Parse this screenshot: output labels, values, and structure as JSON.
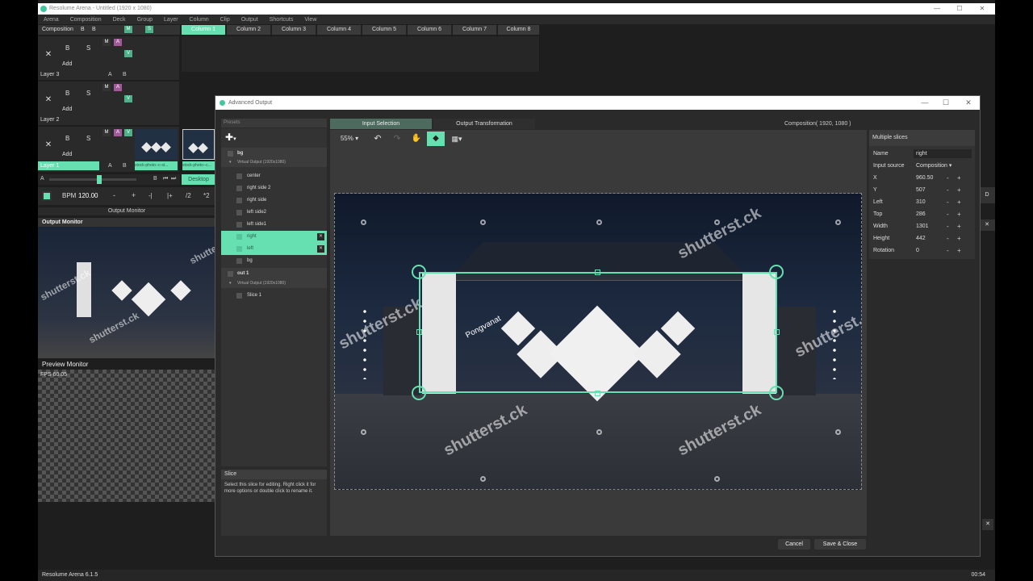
{
  "app": {
    "title": "Resolume Arena - Untitled (1920 x 1080)",
    "version": "Resolume Arena 6.1.5",
    "clock": "00:54",
    "accent": "#66e0b0"
  },
  "menu": [
    "Arena",
    "Composition",
    "Deck",
    "Group",
    "Layer",
    "Column",
    "Clip",
    "Output",
    "Shortcuts",
    "View"
  ],
  "composition": {
    "label": "Composition",
    "b": "B",
    "m": "M",
    "s": "S"
  },
  "columns": [
    "Column 1",
    "Column 2",
    "Column 3",
    "Column 4",
    "Column 5",
    "Column 6",
    "Column 7",
    "Column 8"
  ],
  "layers": [
    {
      "name": "Layer 3",
      "add": "Add"
    },
    {
      "name": "Layer 2",
      "add": "Add"
    },
    {
      "name": "Layer 1",
      "add": "Add"
    }
  ],
  "layer_buttons": {
    "b": "B",
    "s": "S",
    "m": "M",
    "a": "A",
    "v": "V",
    "close": "✕"
  },
  "clips": [
    "stock-photo--c-st...",
    "stock-photo--c..."
  ],
  "crossfader": {
    "a": "A",
    "b": "B",
    "deck": "Desktop"
  },
  "bpm": {
    "label": "BPM",
    "value": "120.00",
    "minus": "-",
    "plus": "+",
    "half": "/2",
    "double": "*2",
    "prev": "-|",
    "next": "|+"
  },
  "output_monitor": {
    "header": "Output Monitor",
    "label": "Output Monitor"
  },
  "preview_monitor": {
    "label": "Preview Monitor",
    "fps": "FPS 60.05"
  },
  "advanced": {
    "title": "Advanced Output",
    "presets": "Presets",
    "tabs": [
      "Input Selection",
      "Output Transformation"
    ],
    "composition_info": "Composition( 1920, 1080 )",
    "zoom": "55%",
    "tree": [
      {
        "label": "bg",
        "type": "group"
      },
      {
        "label": "Virtual Output (1920x1080)",
        "type": "sub"
      },
      {
        "label": "center",
        "type": "item"
      },
      {
        "label": "right side 2",
        "type": "item"
      },
      {
        "label": "right side",
        "type": "item"
      },
      {
        "label": "left side2",
        "type": "item"
      },
      {
        "label": "left side1",
        "type": "item"
      },
      {
        "label": "right",
        "type": "selected"
      },
      {
        "label": "left",
        "type": "selected"
      },
      {
        "label": "bg",
        "type": "item"
      },
      {
        "label": "out 1",
        "type": "group"
      },
      {
        "label": "Virtual Output (1920x1080)",
        "type": "sub"
      },
      {
        "label": "Slice 1",
        "type": "item"
      }
    ],
    "slice_info": {
      "title": "Slice",
      "text": "Select this slice for editing. Right click it for more options or double click to rename it."
    },
    "watermark": "shutterstock",
    "watermark_alt": "shutterst.ck",
    "credit": "Pongvanat",
    "props": {
      "header": "Multiple slices",
      "rows": [
        {
          "key": "Name",
          "value": "right"
        },
        {
          "key": "Input source",
          "value": "Composition ▾"
        },
        {
          "key": "X",
          "value": "960.50"
        },
        {
          "key": "Y",
          "value": "507"
        },
        {
          "key": "Left",
          "value": "310"
        },
        {
          "key": "Top",
          "value": "286"
        },
        {
          "key": "Width",
          "value": "1301"
        },
        {
          "key": "Height",
          "value": "442"
        },
        {
          "key": "Rotation",
          "value": "0"
        }
      ]
    },
    "cancel": "Cancel",
    "save": "Save & Close"
  },
  "right_edge": {
    "d": "D",
    "x": "✕"
  }
}
